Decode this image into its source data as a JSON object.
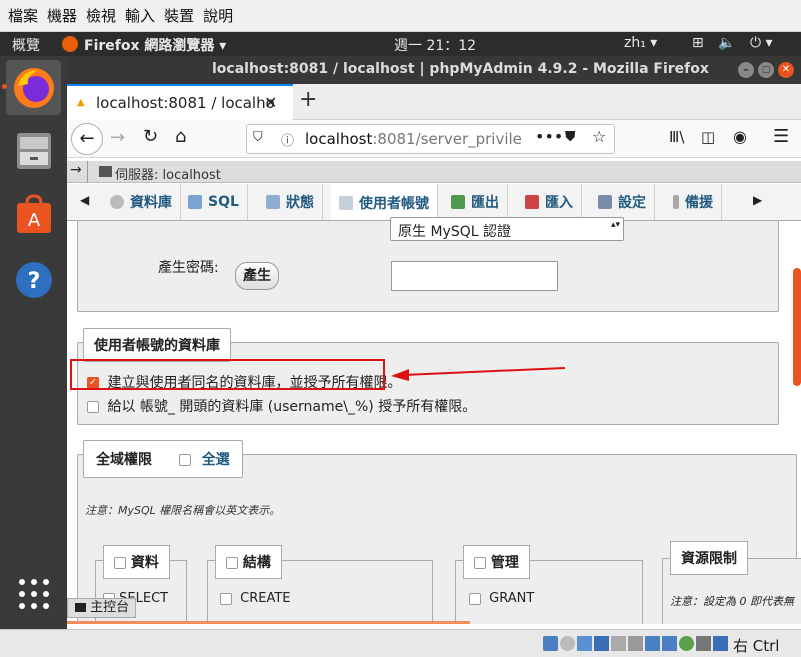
{
  "vm_menu": [
    "檔案",
    "機器",
    "檢視",
    "輸入",
    "裝置",
    "說明"
  ],
  "topbar": {
    "activities": "概覽",
    "app": "Firefox 網路瀏覽器",
    "clock": "週一 21：12",
    "ime": "zh₁"
  },
  "window": {
    "title": "localhost:8081 / localhost | phpMyAdmin 4.9.2 - Mozilla Firefox"
  },
  "tab": {
    "title": "localhost:8081 / localho",
    "close": "✕",
    "new": "+"
  },
  "url": {
    "host": "localhost",
    "rest": ":8081/server_privile"
  },
  "pma": {
    "breadcrumb": "伺服器: localhost",
    "tabs": [
      "資料庫",
      "SQL",
      "狀態",
      "使用者帳號",
      "匯出",
      "匯入",
      "設定",
      "備援"
    ],
    "auth_select": "原生 MySQL 認證",
    "gen_pw_label": "產生密碼:",
    "gen_button": "產生",
    "db_legend": "使用者帳號的資料庫",
    "opt1": "建立與使用者同名的資料庫，並授予所有權限。",
    "opt2": "給以 帳號_ 開頭的資料庫 (username\\_%) 授予所有權限。",
    "global_legend": "全域權限",
    "select_all": "全選",
    "note": "注意：MySQL 權限名稱會以英文表示。",
    "groups": {
      "data": "資料",
      "structure": "結構",
      "admin": "管理",
      "resource": "資源限制"
    },
    "privs": {
      "select": "SELECT",
      "create": "CREATE",
      "grant": "GRANT"
    },
    "resource_note": "注意：設定為 0 即代表無",
    "console": "主控台"
  },
  "status": {
    "host_key": "右 Ctrl"
  },
  "colors": {
    "highlight": "#dd1111",
    "link": "#235a81",
    "checkbox": "#e95420"
  }
}
